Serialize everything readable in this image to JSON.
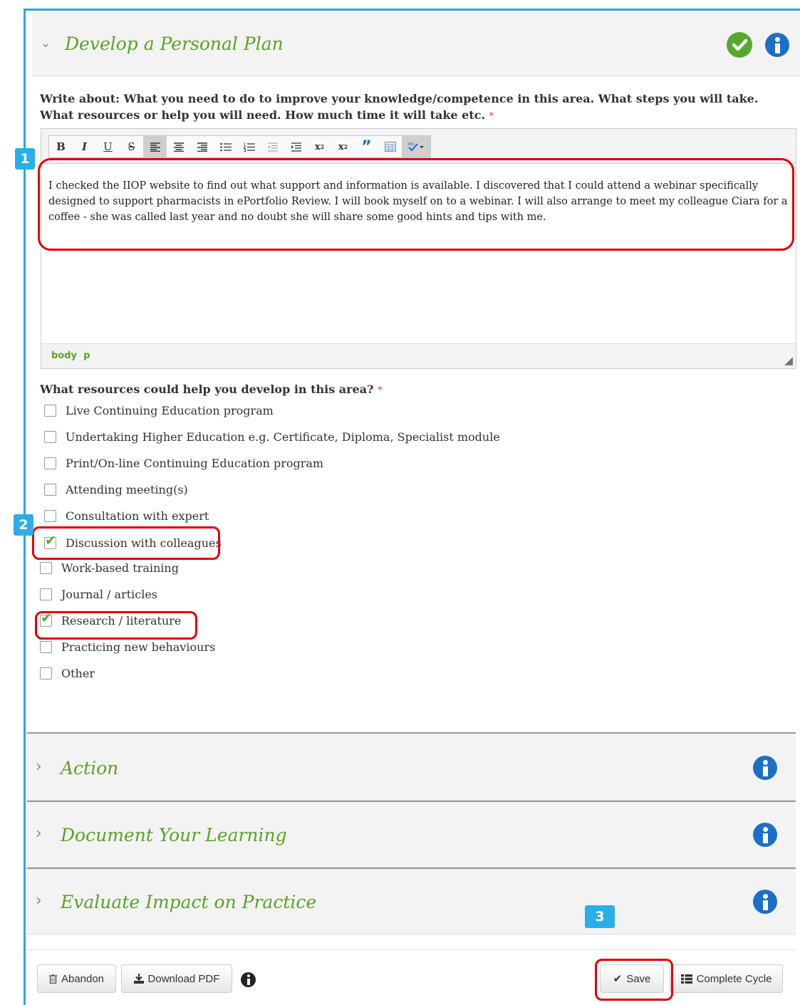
{
  "sections": {
    "develop": {
      "title": "Develop a Personal Plan"
    },
    "action": {
      "title": "Action"
    },
    "document": {
      "title": "Document Your Learning"
    },
    "evaluate": {
      "title": "Evaluate Impact on Practice"
    }
  },
  "prompt": {
    "text": "Write about: What you need to do to improve your knowledge/competence in this area. What steps you will take. What resources or help you will need. How much time it will take etc.",
    "required_mark": "*"
  },
  "editor": {
    "toolbar": [
      "B",
      "I",
      "U",
      "S",
      "align-left",
      "align-center",
      "align-right",
      "bullet-list",
      "numbered-list",
      "outdent",
      "indent",
      "x²",
      "x₂",
      "quote",
      "table",
      "spellcheck"
    ],
    "content": "I checked the IIOP website to find out what support and information is available. I discovered that I could attend a webinar specifically designed to support pharmacists in ePortfolio Review. I will book myself on to a webinar. I will also arrange to meet my colleague Ciara for a coffee - she was called last year and no doubt she will share some good hints and tips with me.",
    "path": "body  p"
  },
  "resources": {
    "question": "What resources could help you develop in this area?",
    "required_mark": "*",
    "options": [
      {
        "label": "Live Continuing Education program",
        "checked": false
      },
      {
        "label": "Undertaking Higher Education e.g. Certificate, Diploma, Specialist module",
        "checked": false
      },
      {
        "label": "Print/On-line Continuing Education program",
        "checked": false
      },
      {
        "label": "Attending meeting(s)",
        "checked": false
      },
      {
        "label": "Consultation with expert",
        "checked": false
      },
      {
        "label": "Discussion with colleagues",
        "checked": true
      },
      {
        "label": "Work-based training",
        "checked": false
      },
      {
        "label": "Journal / articles",
        "checked": false
      },
      {
        "label": "Research / literature",
        "checked": true
      },
      {
        "label": "Practicing new behaviours",
        "checked": false
      },
      {
        "label": "Other",
        "checked": false
      }
    ]
  },
  "markers": [
    "1",
    "2",
    "3"
  ],
  "footer": {
    "abandon": "Abandon",
    "download": "Download PDF",
    "save": "Save",
    "complete": "Complete Cycle"
  },
  "colors": {
    "accent_green": "#5aa229",
    "frame_blue": "#29a8e0",
    "highlight_red": "#e00000",
    "marker_blue": "#2aaee9"
  }
}
